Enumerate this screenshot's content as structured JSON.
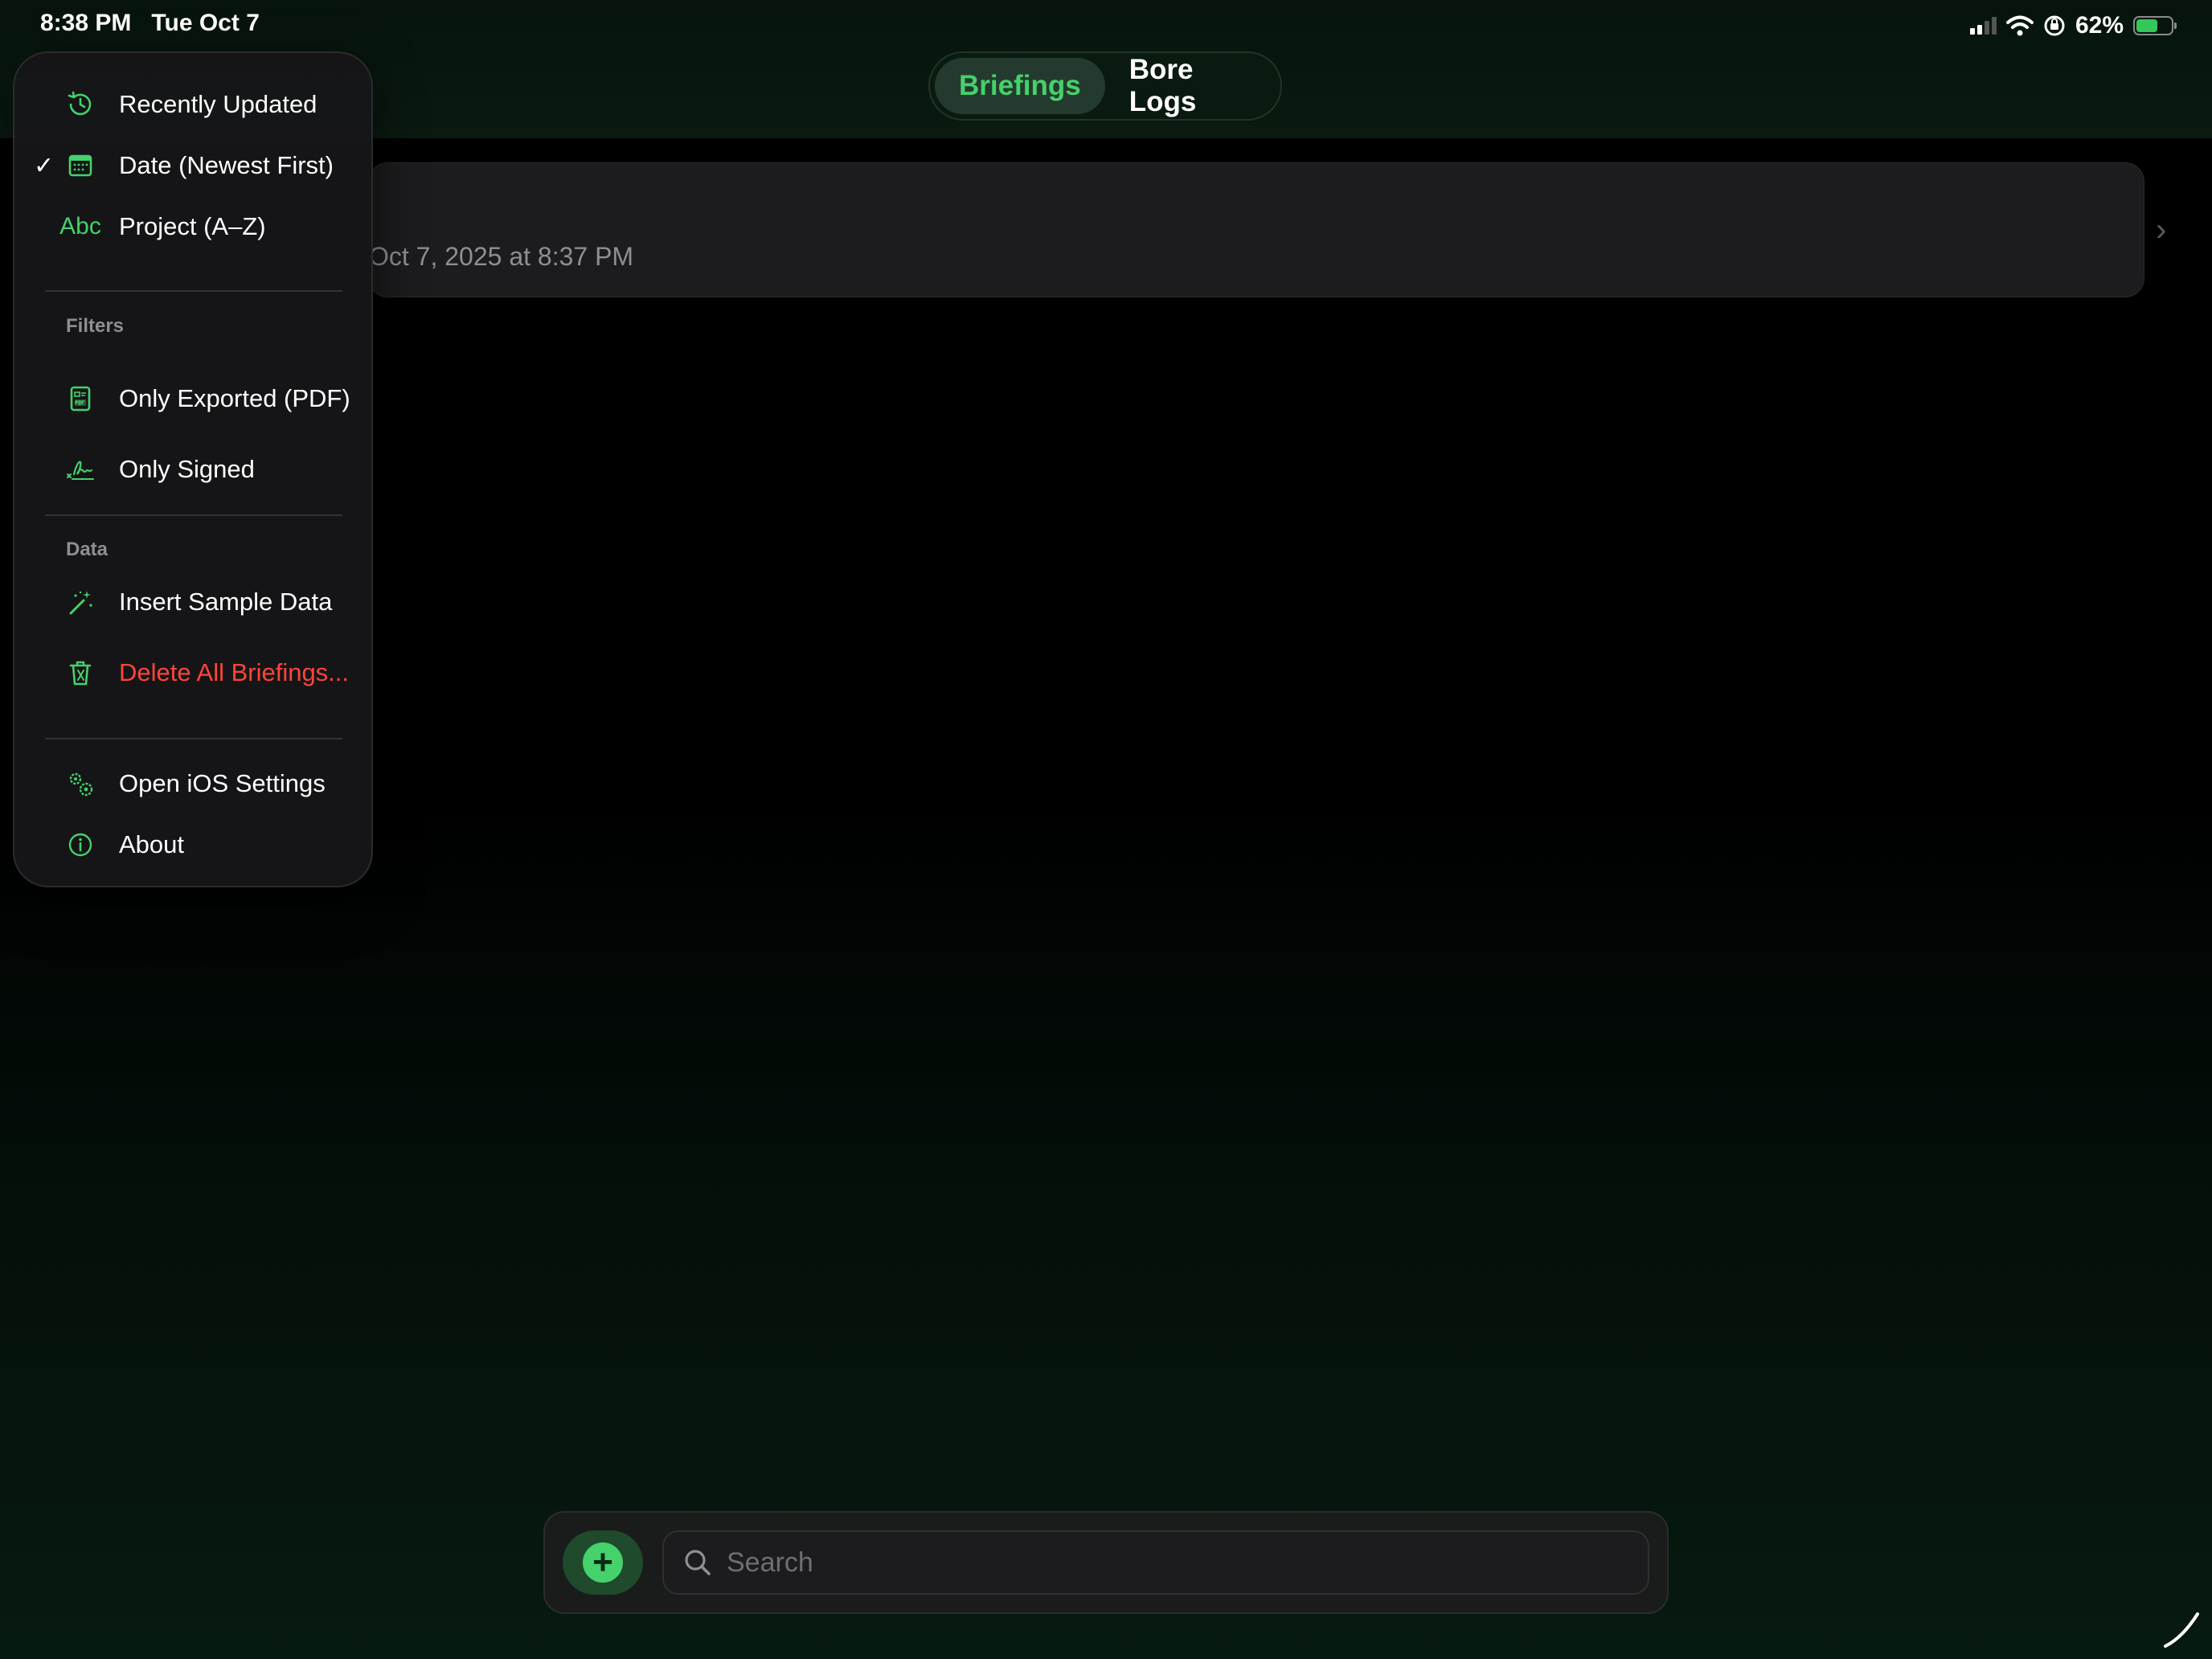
{
  "status_bar": {
    "time": "8:38 PM",
    "date": "Tue Oct 7",
    "battery": "62%",
    "battery_level": 0.62,
    "icons": [
      "signal-icon",
      "wifi-icon",
      "orientation-lock-icon",
      "battery-icon"
    ]
  },
  "tabs": [
    {
      "label": "Briefings",
      "selected": true
    },
    {
      "label": "Bore Logs",
      "selected": false
    }
  ],
  "list": {
    "items": [
      {
        "date": "Oct 7, 2025 at 8:37 PM"
      }
    ]
  },
  "menu": {
    "sort": [
      {
        "label": "Recently Updated",
        "icon": "clock-arrow-icon",
        "checked": false
      },
      {
        "label": "Date (Newest First)",
        "icon": "calendar-icon",
        "checked": true
      },
      {
        "label": "Project (A–Z)",
        "icon": "abc-icon",
        "icon_text": "Abc",
        "checked": false
      }
    ],
    "filters_header": "Filters",
    "filters": [
      {
        "label": "Only Exported (PDF)",
        "icon": "pdf-document-icon"
      },
      {
        "label": "Only Signed",
        "icon": "signature-icon"
      }
    ],
    "data_header": "Data",
    "data": [
      {
        "label": "Insert Sample Data",
        "icon": "magic-wand-icon"
      },
      {
        "label": "Delete All Briefings...",
        "icon": "trash-icon",
        "destructive": true
      }
    ],
    "other": [
      {
        "label": "Open iOS Settings",
        "icon": "gears-icon"
      },
      {
        "label": "About",
        "icon": "info-icon"
      }
    ]
  },
  "search": {
    "placeholder": "Search"
  },
  "colors": {
    "accent": "#45d16b",
    "destructive": "#ff453a",
    "background": "#000000",
    "card": "#1c1c1e"
  }
}
